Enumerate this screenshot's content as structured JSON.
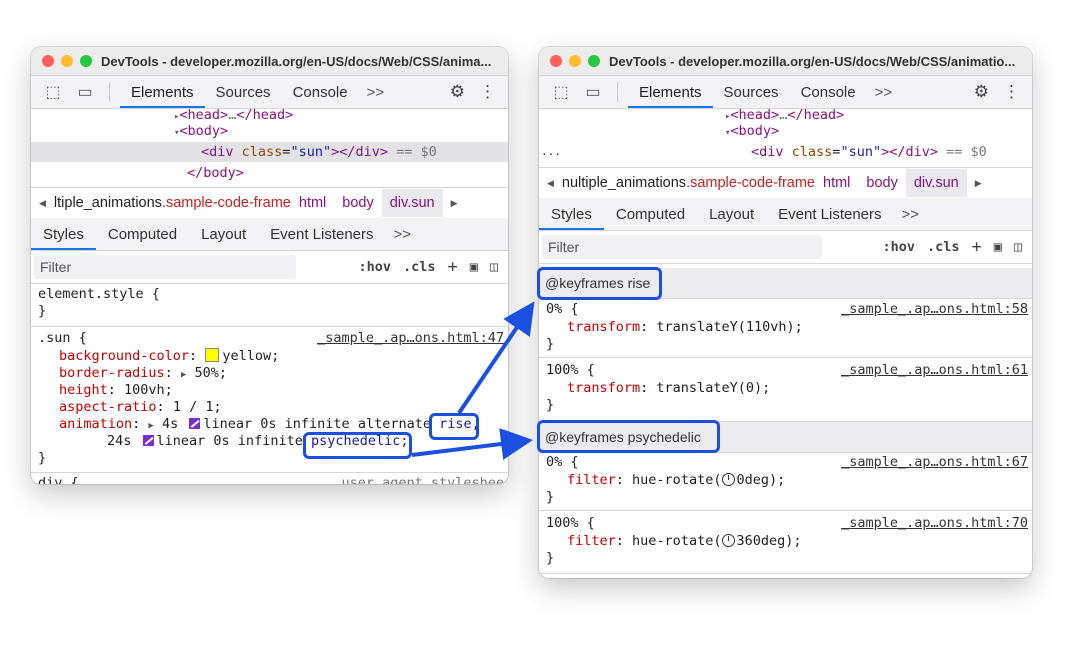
{
  "left": {
    "title": "DevTools - developer.mozilla.org/en-US/docs/Web/CSS/anima...",
    "tabs": [
      "Elements",
      "Sources",
      "Console"
    ],
    "more": ">>",
    "tree": {
      "head": "<head>",
      "head_close": "</head>",
      "body_open": "<body>",
      "div_open": "<div",
      "div_attr": "class",
      "div_val": "\"sun\"",
      "div_close": "></div>",
      "eq": "== $0",
      "body_close": "</body>"
    },
    "crumbs": [
      "ltiple_animations",
      ".sample-code-frame",
      "html",
      "body",
      "div.sun"
    ],
    "subtabs": [
      "Styles",
      "Computed",
      "Layout",
      "Event Listeners"
    ],
    "filter_placeholder": "Filter",
    "hov": ":hov",
    "cls": ".cls",
    "element_style": "element.style {",
    "brace_close": "}",
    "rule_selector": ".sun {",
    "rule_source": "_sample_.ap…ons.html:47",
    "decl": {
      "bg_prop": "background-color",
      "bg_val": "yellow;",
      "br_prop": "border-radius",
      "br_val": "50%;",
      "h_prop": "height",
      "h_val": "100vh;",
      "ar_prop": "aspect-ratio",
      "ar_val": "1 / 1;",
      "anim_prop": "animation",
      "anim_val1": "4s",
      "anim_val2": "linear 0s infinite alternate",
      "anim_rise": "rise,",
      "anim_val3": "24s",
      "anim_val4": "linear 0s infinite",
      "anim_psy": "psychedelic;"
    },
    "div_selector": "div {",
    "div_source": "user agent styleshee"
  },
  "right": {
    "title": "DevTools - developer.mozilla.org/en-US/docs/Web/CSS/animatio...",
    "tabs": [
      "Elements",
      "Sources",
      "Console"
    ],
    "more": ">>",
    "dots": "...",
    "crumbs": [
      "nultiple_animations",
      ".sample-code-frame",
      "html",
      "body",
      "div.sun"
    ],
    "subtabs": [
      "Styles",
      "Computed",
      "Layout",
      "Event Listeners"
    ],
    "filter_placeholder": "Filter",
    "hov": ":hov",
    "cls": ".cls",
    "kf1": {
      "header": "@keyframes rise",
      "r1_sel": "0% {",
      "r1_src": "_sample_.ap…ons.html:58",
      "r1_prop": "transform",
      "r1_val": "translateY(110vh);",
      "r2_sel": "100% {",
      "r2_src": "_sample_.ap…ons.html:61",
      "r2_prop": "transform",
      "r2_val": "translateY(0);"
    },
    "kf2": {
      "header": "@keyframes psychedelic",
      "r1_sel": "0% {",
      "r1_src": "_sample_.ap…ons.html:67",
      "r1_prop": "filter",
      "r1_val_a": "hue-rotate(",
      "r1_val_b": "0deg);",
      "r2_sel": "100% {",
      "r2_src": "_sample_.ap…ons.html:70",
      "r2_prop": "filter",
      "r2_val_a": "hue-rotate(",
      "r2_val_b": "360deg);"
    },
    "brace_close": "}"
  },
  "colors": {
    "accent": "#1a73e8",
    "highlight": "#1a4fe0",
    "traffic_red": "#ff5f57",
    "traffic_yellow": "#febc2e",
    "traffic_green": "#28c840"
  },
  "icons": [
    "inspect-icon",
    "device-toggle-icon",
    "gear-icon",
    "kebab-menu-icon",
    "new-rule-icon",
    "paint-icon",
    "sidebar-toggle-icon"
  ]
}
